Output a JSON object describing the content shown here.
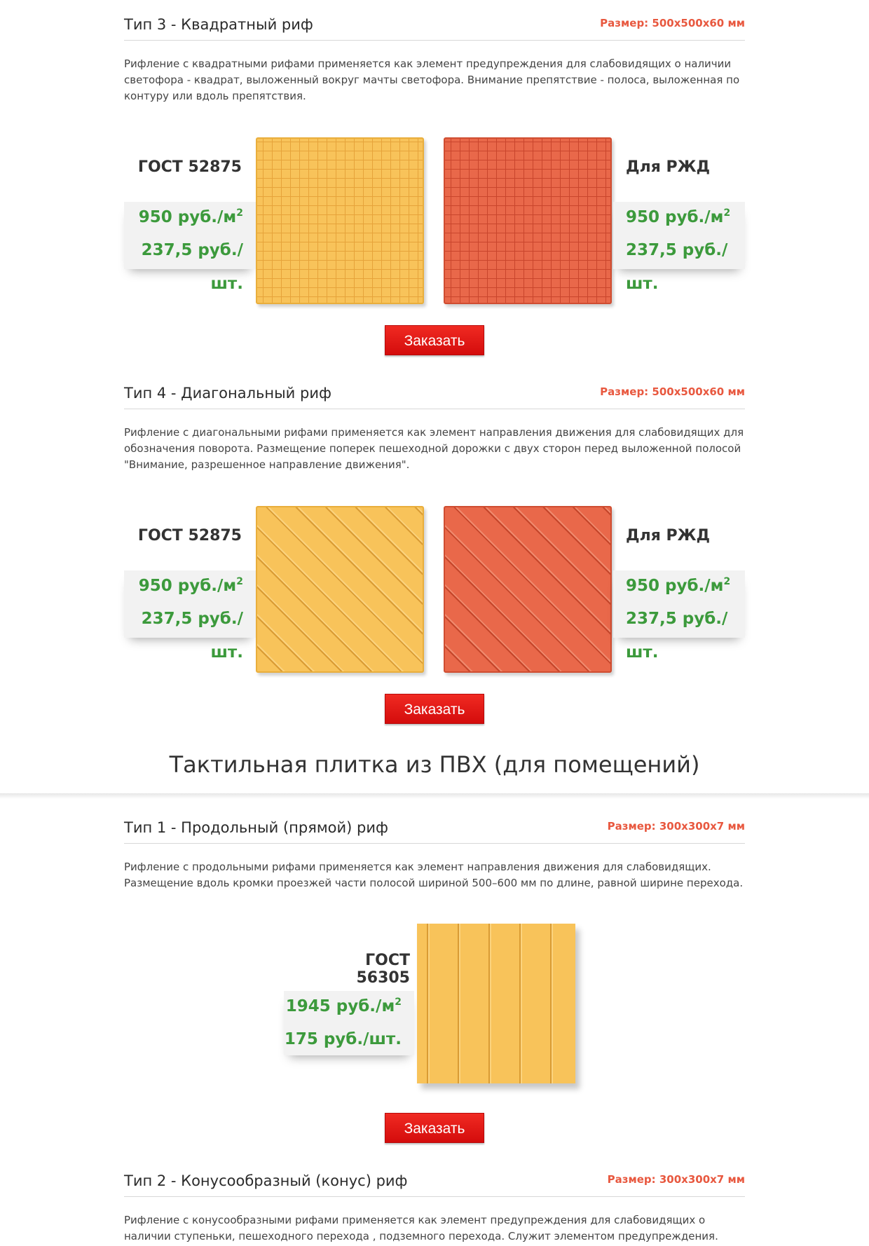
{
  "sections": [
    {
      "title": "Тип 3 - Квадратный риф",
      "size": "Размер: 500x500x60 мм",
      "description": "Рифление с квадратными рифами применяется как элемент предупреждения для слабовидящих о наличии светофора - квадрат, выложенный вокруг мачты светофора. Внимание препятствие - полоса, выложенная по контуру или вдоль препятствия.",
      "left": {
        "label": "ГОСТ 52875",
        "price_m2": "950 руб./м",
        "price_sup": "2",
        "price_unit": "237,5 руб./",
        "price_unit2": "шт."
      },
      "right": {
        "label": "Для РЖД",
        "price_m2": "950 руб./м",
        "price_sup": "2",
        "price_unit": "237,5 руб./",
        "price_unit2": "шт."
      },
      "button": "Заказать"
    },
    {
      "title": "Тип 4 - Диагональный риф",
      "size": "Размер: 500x500x60 мм",
      "description": "Рифление с диагональными рифами применяется как элемент направления движения для слабовидящих для обозначения поворота. Размещение поперек пешеходной дорожки с двух сторон перед выложенной полосой \"Внимание, разрешенное направление движения\".",
      "left": {
        "label": "ГОСТ 52875",
        "price_m2": "950 руб./м",
        "price_sup": "2",
        "price_unit": "237,5 руб./",
        "price_unit2": "шт."
      },
      "right": {
        "label": "Для РЖД",
        "price_m2": "950 руб./м",
        "price_sup": "2",
        "price_unit": "237,5 руб./",
        "price_unit2": "шт."
      },
      "button": "Заказать"
    }
  ],
  "pvc_heading": "Тактильная плитка из ПВХ (для помещений)",
  "pvc_sections": [
    {
      "title": "Тип 1 - Продольный (прямой) риф",
      "size": "Размер: 300x300x7 мм",
      "description": "Рифление с продольными рифами применяется как элемент направления движения для слабовидящих. Размещение вдоль кромки проезжей части полосой шириной 500–600 мм по длине, равной ширине перехода.",
      "label": "ГОСТ 56305",
      "price_m2": "1945 руб./м",
      "price_sup": "2",
      "price_unit": "175 руб./шт.",
      "button": "Заказать"
    },
    {
      "title": "Тип 2 - Конусообразный (конус) риф",
      "size": "Размер: 300x300x7 мм",
      "description": "Рифление с конусообразными рифами применяется как элемент предупреждения для слабовидящих о наличии ступеньки, пешеходного перехода , подземного перехода. Служит элементом предупреждения. Размещение вдоль"
    }
  ]
}
